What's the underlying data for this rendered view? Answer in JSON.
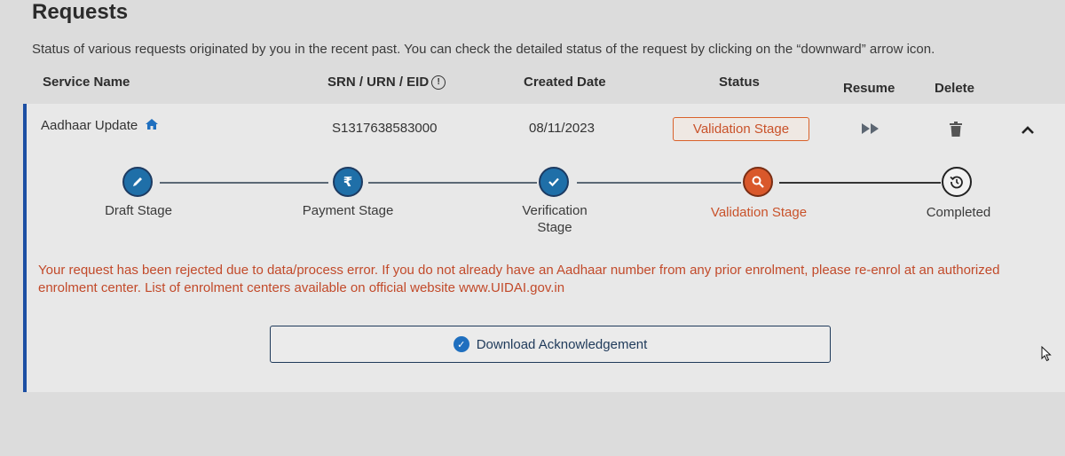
{
  "header": {
    "title": "Requests",
    "description": "Status of various requests originated by you in the recent past. You can check the detailed status of the request by clicking on the “downward” arrow icon."
  },
  "columns": {
    "service_name": "Service Name",
    "srn": "SRN / URN / EID",
    "created_date": "Created Date",
    "status": "Status",
    "resume": "Resume",
    "delete": "Delete"
  },
  "request": {
    "service_name": "Aadhaar Update",
    "srn": "S1317638583000",
    "created_date": "08/11/2023",
    "status": "Validation Stage"
  },
  "stages": [
    {
      "label": "Draft Stage",
      "icon": "pencil-icon",
      "state": "done"
    },
    {
      "label": "Payment Stage",
      "icon": "rupee-icon",
      "state": "done"
    },
    {
      "label": "Verification Stage",
      "icon": "check-icon",
      "state": "done"
    },
    {
      "label": "Validation Stage",
      "icon": "search-icon",
      "state": "current"
    },
    {
      "label": "Completed",
      "icon": "history-icon",
      "state": "pending"
    }
  ],
  "message": "Your request has been rejected due to data/process error. If you do not already have an Aadhaar number from any prior enrolment, please re-enrol at an authorized enrolment center. List of enrolment centers available on official website www.UIDAI.gov.in",
  "download_label": "Download Acknowledgement",
  "colors": {
    "accent": "#1c4fa3",
    "done_stage": "#1f6fa8",
    "current_stage": "#d9582b",
    "error_text": "#c24a2a"
  }
}
